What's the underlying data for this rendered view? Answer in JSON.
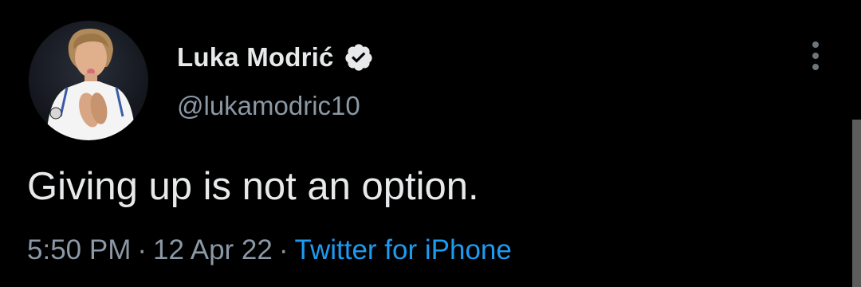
{
  "tweet": {
    "author": {
      "display_name": "Luka Modrić",
      "handle": "@lukamodric10",
      "verified": true,
      "avatar": "profile-photo"
    },
    "text": "Giving up is not an option.",
    "time": "5:50 PM",
    "date": "12 Apr 22",
    "source": "Twitter for iPhone",
    "separator": "·",
    "more_icon": "more-vertical-icon",
    "verified_icon": "verified-badge-icon"
  },
  "colors": {
    "background": "#000000",
    "text_primary": "#e7e9ea",
    "text_secondary": "#8b98a5",
    "link": "#1d9bf0"
  }
}
